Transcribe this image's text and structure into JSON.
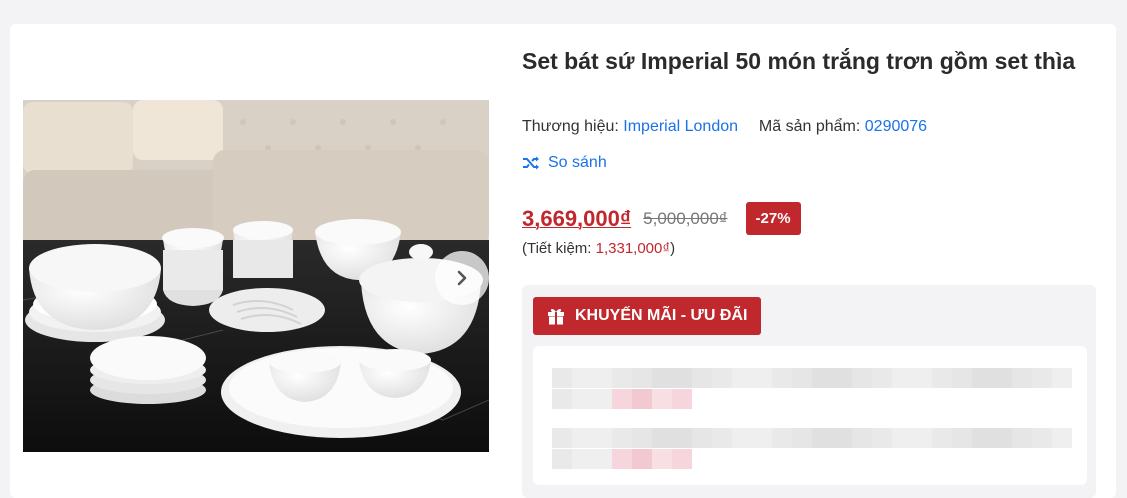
{
  "product": {
    "title": "Set bát sứ Imperial 50 món trắng trơn gồm set thìa",
    "brand_label": "Thương hiệu:",
    "brand_value": "Imperial London",
    "sku_label": "Mã sản phẩm:",
    "sku_value": "0290076",
    "compare_label": "So sánh",
    "price": "3,669,000₫",
    "old_price": "5,000,000₫",
    "discount": "-27%",
    "saving_label": "(Tiết kiệm:",
    "saving_value": "1,331,000₫",
    "saving_close": ")"
  },
  "promo": {
    "heading": "KHUYẾN MÃI - ƯU ĐÃI"
  },
  "gallery": {
    "next_icon": "chevron-right-icon",
    "image_alt": "white porcelain bowl and plate set on table in front of beige sofa"
  },
  "colors": {
    "accent_red": "#c0282d",
    "link_blue": "#1a73e8"
  }
}
